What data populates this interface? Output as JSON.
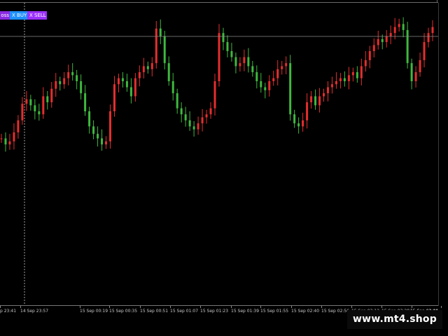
{
  "toolbar": {
    "cross_label": "oss",
    "buy_label": "X BUY",
    "sell_label": "X SELL"
  },
  "watermark": {
    "text": "www.mt4.shop"
  },
  "colors": {
    "background": "#000000",
    "bull": "#e52e2e",
    "bear": "#3fb83f",
    "crosshair": "#c8c8c8",
    "hline": "#8c8c8c"
  },
  "chart_data": {
    "type": "candlestick",
    "title": "",
    "xlabel": "",
    "ylabel": "",
    "x_tick_labels": [
      "p 23:41",
      "14 Sep 23:57",
      "15 Sep 00:19",
      "15 Sep 00:35",
      "15 Sep 00:51",
      "15 Sep 01:07",
      "15 Sep 01:23",
      "15 Sep 01:39",
      "15 Sep 01:55",
      "15 Sep 02:40",
      "15 Sep 02:56",
      "15 Sep 03:12",
      "15 Sep 03:28",
      "15 Sep 03:44",
      "15 Sep 04:00"
    ],
    "closes_relative": [
      0.22,
      0.18,
      0.2,
      0.26,
      0.34,
      0.45,
      0.48,
      0.44,
      0.4,
      0.38,
      0.5,
      0.46,
      0.55,
      0.6,
      0.58,
      0.62,
      0.66,
      0.64,
      0.6,
      0.52,
      0.4,
      0.3,
      0.25,
      0.22,
      0.18,
      0.2,
      0.4,
      0.58,
      0.62,
      0.6,
      0.56,
      0.5,
      0.62,
      0.66,
      0.7,
      0.68,
      0.72,
      0.95,
      0.9,
      0.72,
      0.6,
      0.52,
      0.42,
      0.38,
      0.34,
      0.3,
      0.28,
      0.32,
      0.36,
      0.38,
      0.42,
      0.6,
      0.92,
      0.86,
      0.8,
      0.76,
      0.7,
      0.72,
      0.76,
      0.7,
      0.66,
      0.6,
      0.56,
      0.54,
      0.6,
      0.62,
      0.68,
      0.7,
      0.72,
      0.38,
      0.32,
      0.3,
      0.34,
      0.46,
      0.5,
      0.44,
      0.5,
      0.52,
      0.56,
      0.58,
      0.6,
      0.62,
      0.6,
      0.64,
      0.66,
      0.62,
      0.7,
      0.74,
      0.8,
      0.84,
      0.88,
      0.86,
      0.9,
      0.92,
      0.96,
      0.98,
      0.94,
      0.72,
      0.6,
      0.66,
      0.74,
      0.86,
      0.92,
      0.96
    ],
    "crosshair_vertical_at_label": "14 Sep 23:57",
    "grid": false,
    "legend": "none"
  }
}
